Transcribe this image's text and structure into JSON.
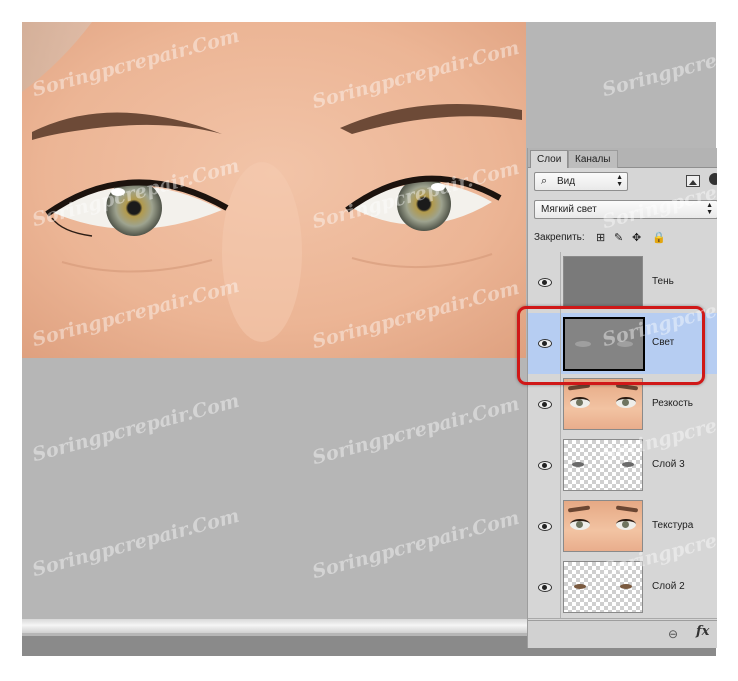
{
  "panel": {
    "tabs": [
      "Слои",
      "Каналы"
    ],
    "filter": {
      "label": "Вид",
      "search_glyph": "⌕"
    },
    "blend_mode": "Мягкий свет",
    "lock": {
      "label": "Закрепить:",
      "icons": [
        "lock-transparent-icon",
        "lock-brush-icon",
        "lock-move-icon",
        "lock-all-icon"
      ]
    },
    "layers": [
      {
        "name": "Тень",
        "visible": true,
        "thumbnail": "solid-gray",
        "selected": false
      },
      {
        "name": "Свет",
        "visible": true,
        "thumbnail": "gray-soft-highlights",
        "selected": true
      },
      {
        "name": "Резкость",
        "visible": true,
        "thumbnail": "face-photo",
        "selected": false
      },
      {
        "name": "Слой 3",
        "visible": true,
        "thumbnail": "transparent-with-dark-spots",
        "selected": false
      },
      {
        "name": "Текстура",
        "visible": true,
        "thumbnail": "face-photo",
        "selected": false
      },
      {
        "name": "Слой 2",
        "visible": true,
        "thumbnail": "transparent-with-eye-spots",
        "selected": false
      }
    ],
    "footer": {
      "link_glyph": "⊖",
      "fx_label": "fx"
    }
  },
  "watermark_text": "Soringpcrepair.Com",
  "colors": {
    "canvas_bg": "#b6b6b6",
    "panel_bg": "#d6d6d6",
    "selected_row": "#b6cdf2",
    "highlight_frame": "#d01818"
  }
}
